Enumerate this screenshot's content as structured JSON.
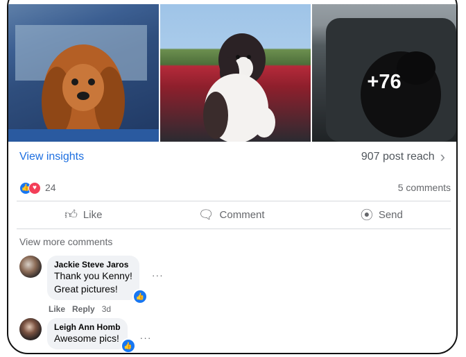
{
  "photos": {
    "more_count": "+76"
  },
  "insights": {
    "link": "View insights",
    "reach": "907 post reach",
    "chevron": "›"
  },
  "reactions": {
    "count": "24",
    "comments": "5 comments"
  },
  "actions": {
    "like": "Like",
    "comment": "Comment",
    "send": "Send"
  },
  "comments_section": {
    "view_more": "View more comments",
    "items": [
      {
        "name": "Jackie Steve Jaros",
        "text_line1": "Thank you Kenny!",
        "text_line2": "Great pictures!",
        "meta_like": "Like",
        "meta_reply": "Reply",
        "meta_time": "3d"
      },
      {
        "name": "Leigh Ann Homb",
        "text_line1": "Awesome pics!"
      }
    ],
    "more_menu": "···"
  },
  "colors": {
    "link": "#1c6ee0",
    "like_blue": "#1877f2",
    "love_red": "#f33e58"
  }
}
